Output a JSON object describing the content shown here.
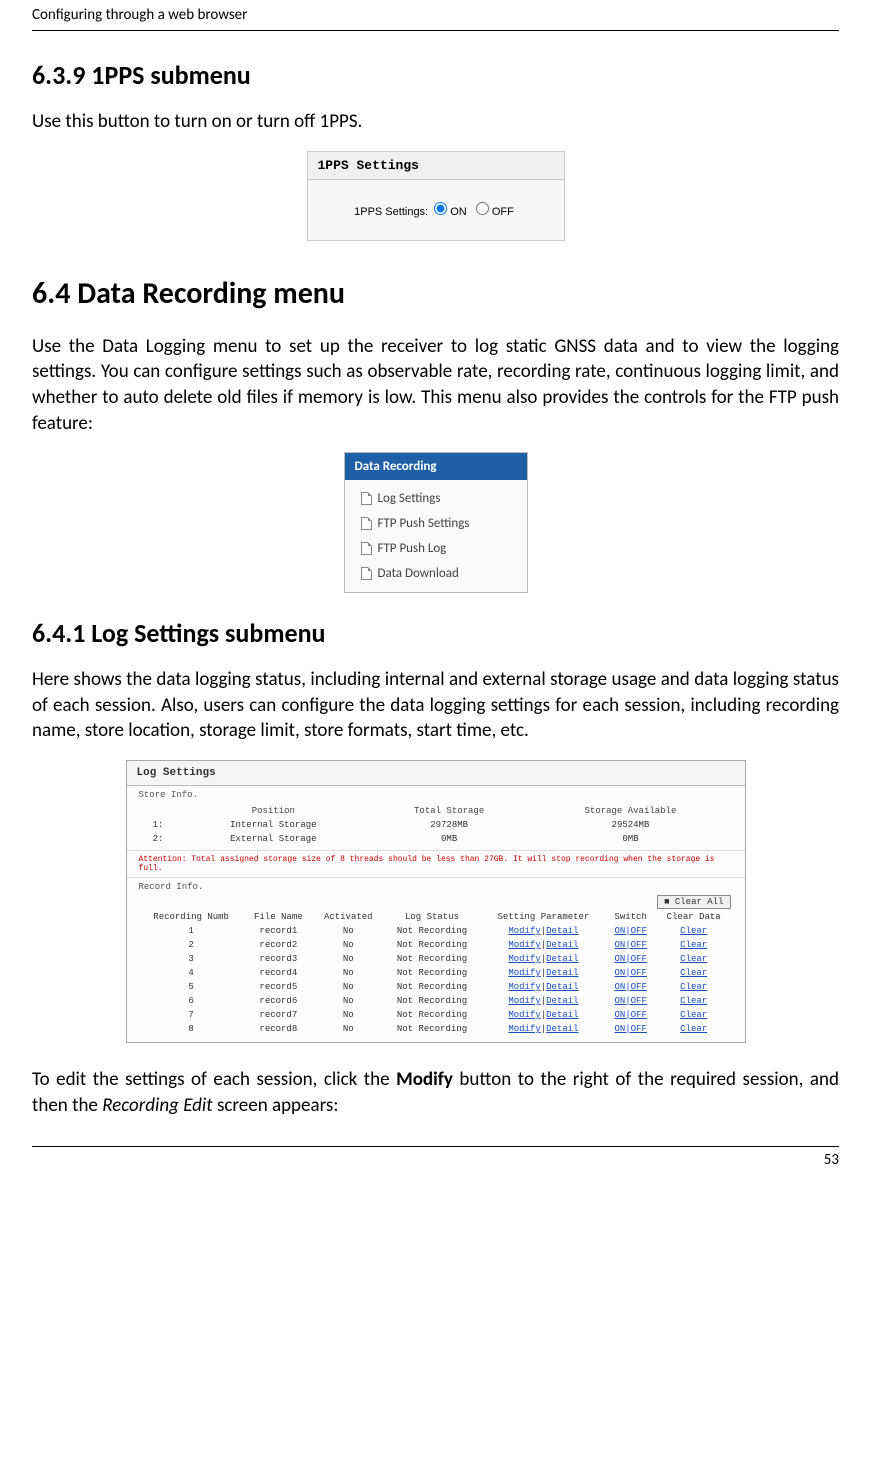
{
  "header": "Configuring through a web browser",
  "s1": {
    "heading": "6.3.9  1PPS submenu",
    "p": "Use this button to turn on or turn off 1PPS.",
    "fig": {
      "title": "1PPS Settings",
      "label": "1PPS Settings:",
      "on": "ON",
      "off": "OFF"
    }
  },
  "s2": {
    "heading": "6.4  Data Recording menu",
    "p": "Use the Data Logging menu to set up the receiver to log static GNSS data and to view the logging settings. You can configure settings such as observable rate, recording rate, continuous logging limit, and whether to auto delete old files if memory is low. This menu also provides the controls for the FTP push feature:",
    "nav": {
      "title": "Data Recording",
      "items": [
        "Log Settings",
        "FTP Push Settings",
        "FTP Push Log",
        "Data Download"
      ]
    }
  },
  "s3": {
    "heading": "6.4.1  Log Settings submenu",
    "p": "Here shows the data logging status, including internal and external storage usage and data logging status of each session. Also, users can configure the data logging settings for each session, including recording name, store location, storage limit, store formats, start time, etc.",
    "fig": {
      "title": "Log Settings",
      "storeHead": "Store Info.",
      "storeCols": [
        "Position",
        "Total Storage",
        "Storage Available"
      ],
      "storeRows": [
        [
          "1:",
          "Internal Storage",
          "29728MB",
          "29524MB"
        ],
        [
          "2:",
          "External Storage",
          "0MB",
          "0MB"
        ]
      ],
      "warn": "Attention: Total assigned storage size of 8 threads should be less than 27GB. It will stop recording when the storage is full.",
      "recHead": "Record Info.",
      "clearAll": "■ Clear All",
      "recCols": [
        "Recording Numb",
        "File Name",
        "Activated",
        "Log Status",
        "Setting Parameter",
        "Switch",
        "Clear Data"
      ],
      "modify": "Modify",
      "detail": "Detail",
      "switch": "ON|OFF",
      "clear": "Clear",
      "rows": [
        {
          "n": "1",
          "f": "record1",
          "a": "No",
          "s": "Not Recording"
        },
        {
          "n": "2",
          "f": "record2",
          "a": "No",
          "s": "Not Recording"
        },
        {
          "n": "3",
          "f": "record3",
          "a": "No",
          "s": "Not Recording"
        },
        {
          "n": "4",
          "f": "record4",
          "a": "No",
          "s": "Not Recording"
        },
        {
          "n": "5",
          "f": "record5",
          "a": "No",
          "s": "Not Recording"
        },
        {
          "n": "6",
          "f": "record6",
          "a": "No",
          "s": "Not Recording"
        },
        {
          "n": "7",
          "f": "record7",
          "a": "No",
          "s": "Not Recording"
        },
        {
          "n": "8",
          "f": "record8",
          "a": "No",
          "s": "Not Recording"
        }
      ]
    },
    "p2a": "To edit the settings of each session, click the ",
    "p2b": "Modify",
    "p2c": " button to the right of the required session, and then the ",
    "p2d": "Recording Edit",
    "p2e": " screen appears:"
  },
  "page": "53"
}
